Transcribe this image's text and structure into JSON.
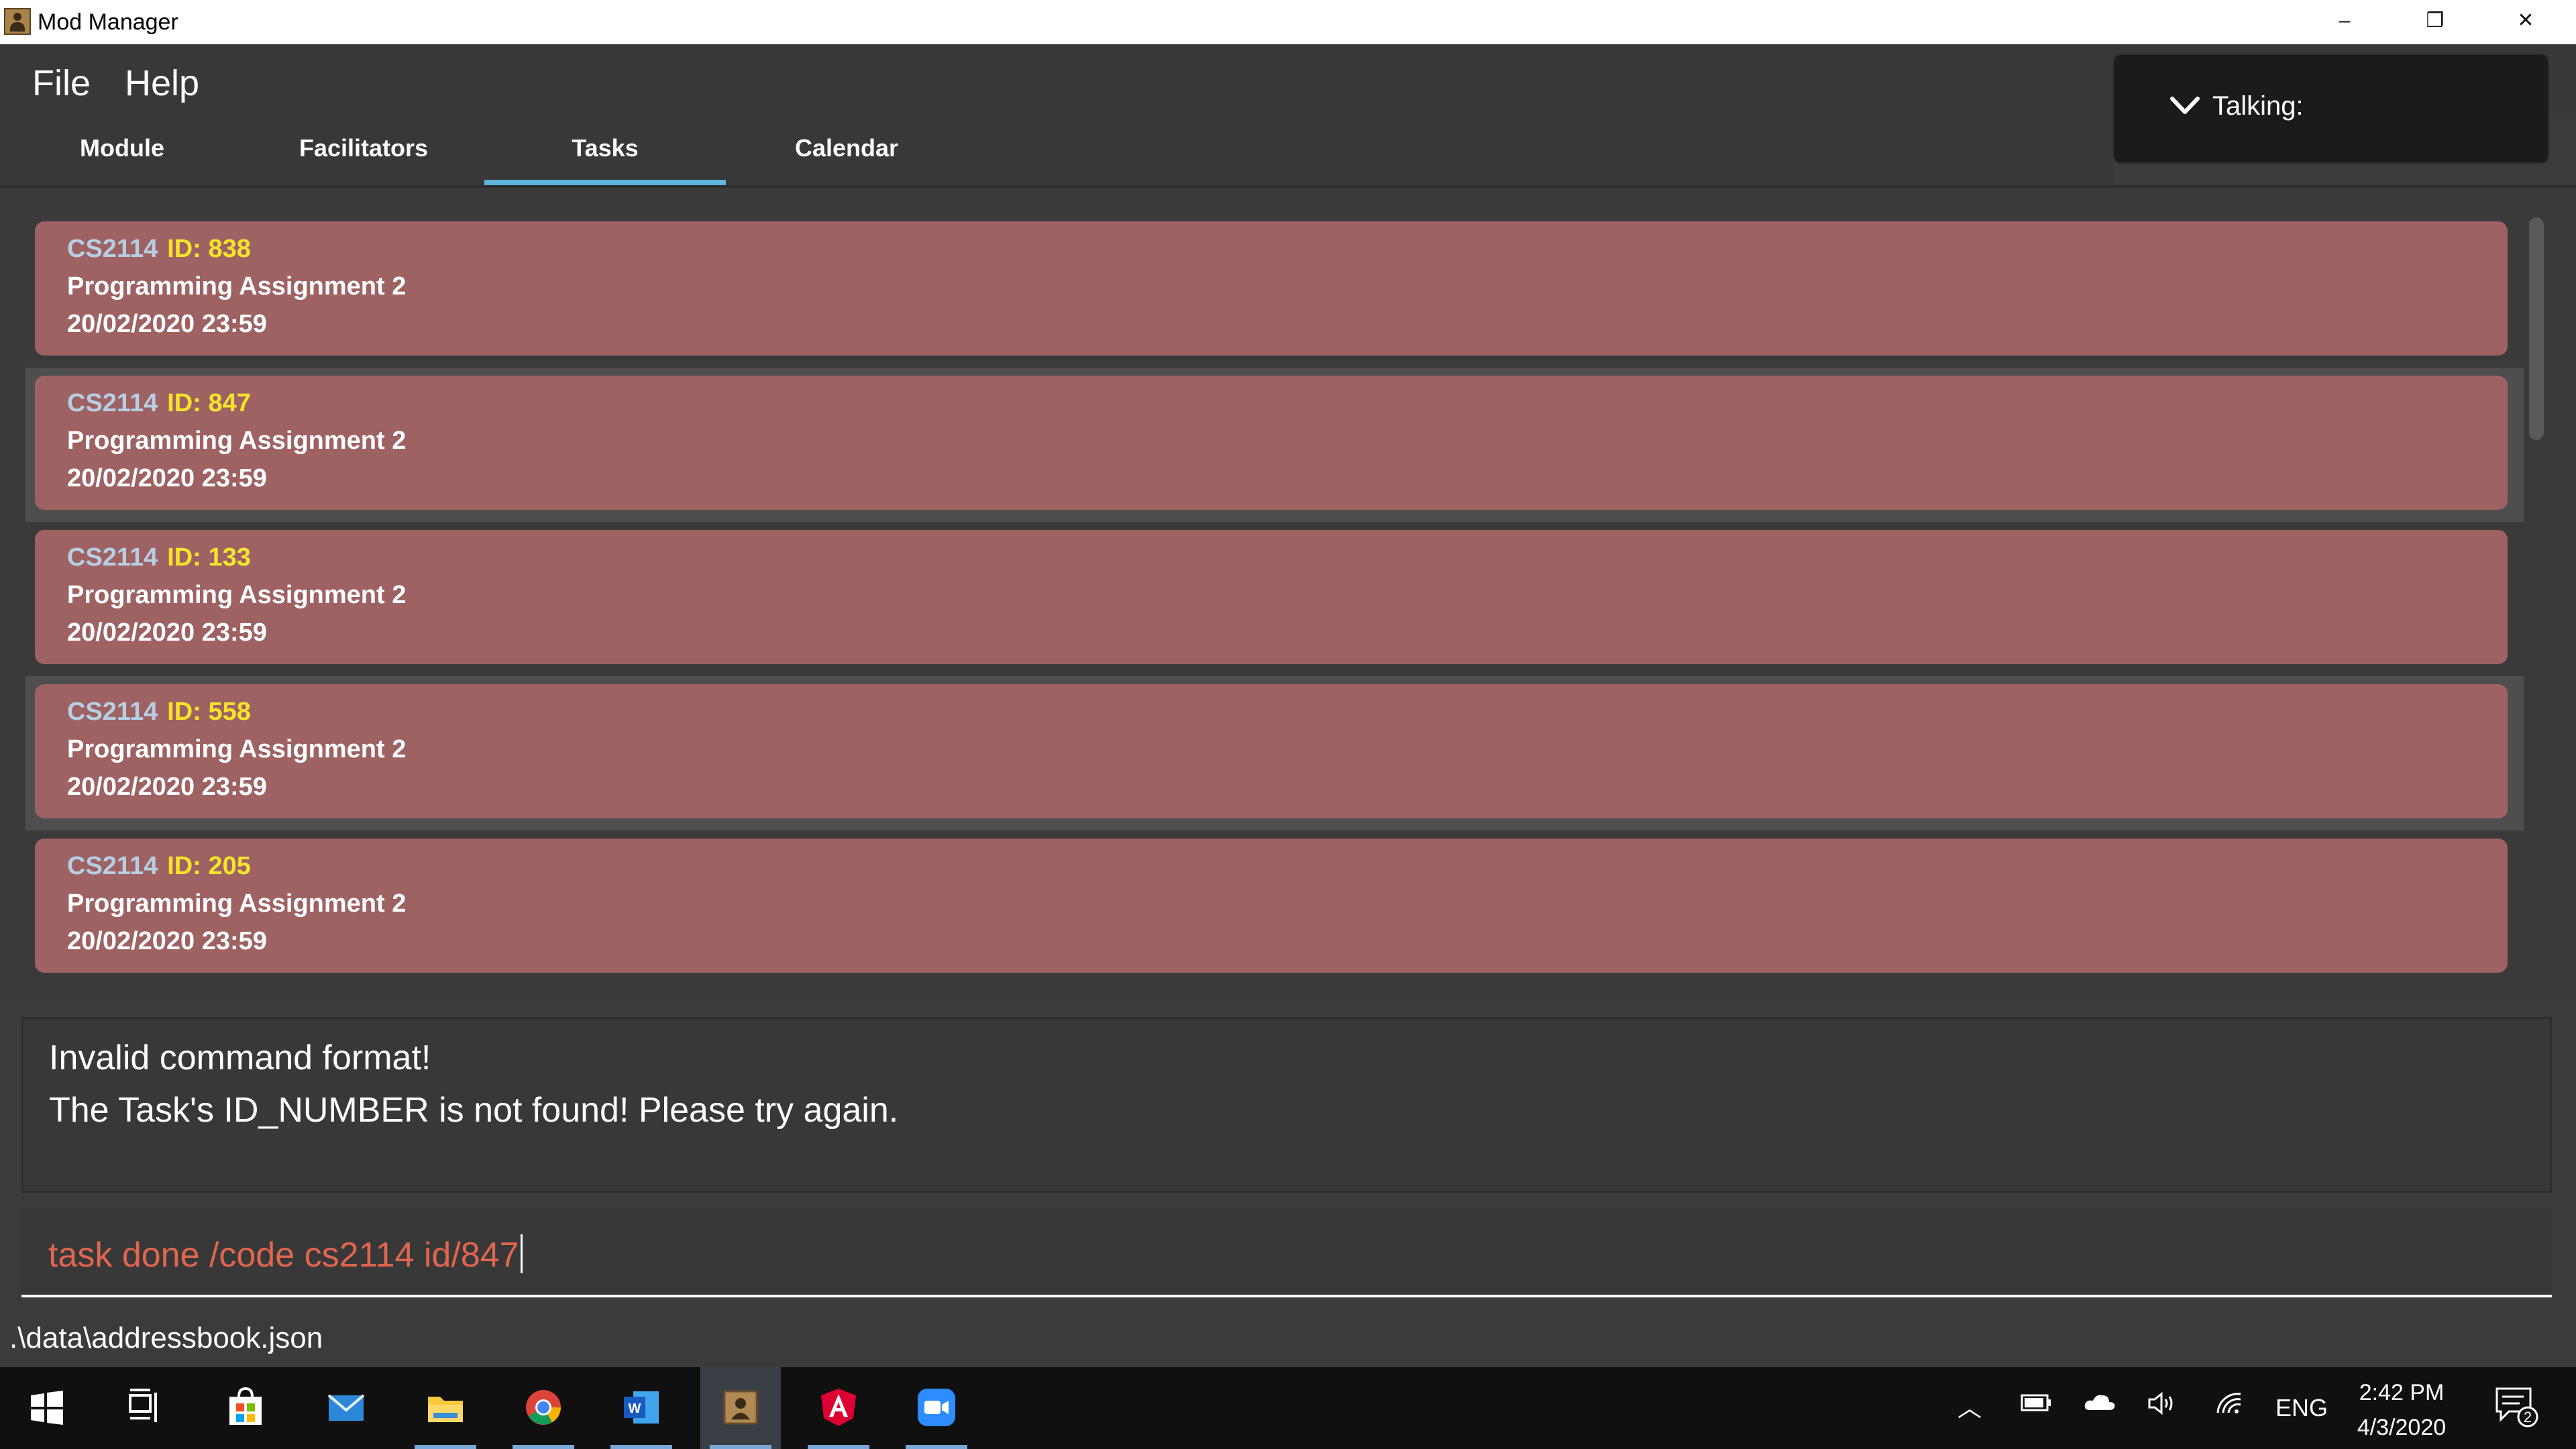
{
  "window": {
    "title": "Mod Manager",
    "controls": {
      "minimize": "–",
      "restore": "❐",
      "close": "✕"
    }
  },
  "menu": {
    "items": [
      {
        "label": "File"
      },
      {
        "label": "Help"
      }
    ]
  },
  "tabs": [
    {
      "label": "Module"
    },
    {
      "label": "Facilitators"
    },
    {
      "label": "Tasks"
    },
    {
      "label": "Calendar"
    }
  ],
  "active_tab": "Tasks",
  "talking": {
    "label": "Talking:"
  },
  "tasks": [
    {
      "code": "CS2114",
      "id_text": "ID: 838",
      "name": "Programming Assignment 2",
      "datetime": "20/02/2020 23:59"
    },
    {
      "code": "CS2114",
      "id_text": "ID: 847",
      "name": "Programming Assignment 2",
      "datetime": "20/02/2020 23:59"
    },
    {
      "code": "CS2114",
      "id_text": "ID: 133",
      "name": "Programming Assignment 2",
      "datetime": "20/02/2020 23:59"
    },
    {
      "code": "CS2114",
      "id_text": "ID: 558",
      "name": "Programming Assignment 2",
      "datetime": "20/02/2020 23:59"
    },
    {
      "code": "CS2114",
      "id_text": "ID: 205",
      "name": "Programming Assignment 2",
      "datetime": "20/02/2020 23:59"
    }
  ],
  "result": {
    "lines": [
      "Invalid command format!",
      "The Task's ID_NUMBER is not found! Please try again."
    ]
  },
  "command": {
    "value": "task done /code cs2114 id/847"
  },
  "status": {
    "path": ".\\data\\addressbook.json"
  },
  "taskbar": {
    "apps": [
      "start-icon",
      "task-view-icon",
      "store-icon",
      "mail-icon",
      "file-explorer-icon",
      "chrome-icon",
      "word-icon",
      "mod-manager-icon",
      "angular-icon",
      "zoom-icon"
    ],
    "tray": {
      "language": "ENG",
      "time": "2:42 PM",
      "date": "4/3/2020",
      "notifications": "2"
    }
  },
  "colors": {
    "card": "#9e6263",
    "id": "#f8e32b",
    "code": "#b6cfe3",
    "accent": "#5fb5dc",
    "command": "#e2664f"
  }
}
